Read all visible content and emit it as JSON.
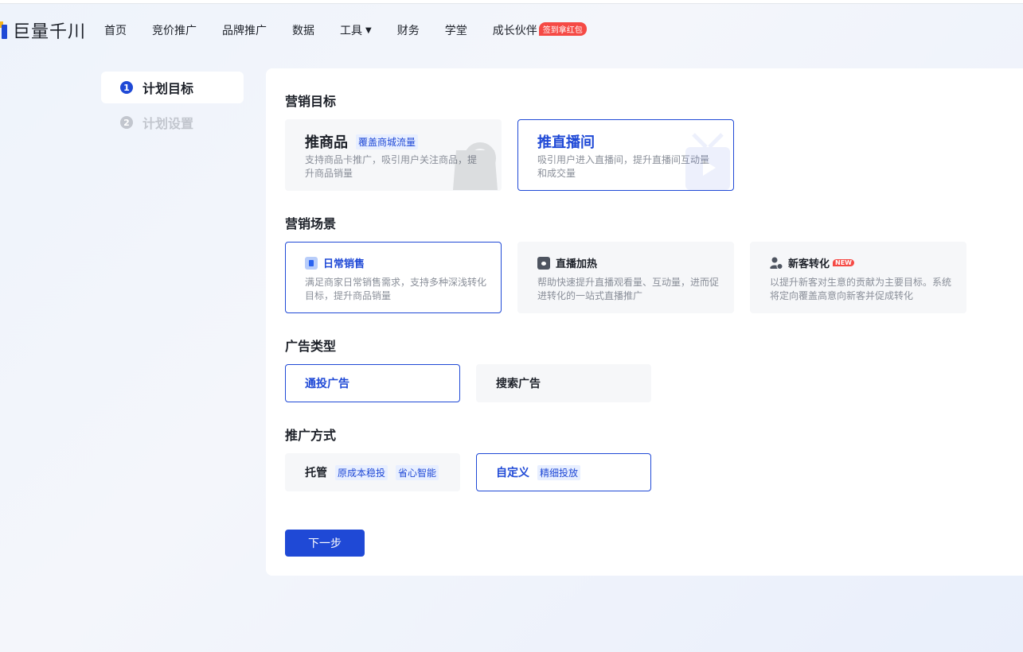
{
  "app": {
    "logo_text": "巨量千川"
  },
  "nav": {
    "items": [
      {
        "label": "首页"
      },
      {
        "label": "竞价推广"
      },
      {
        "label": "品牌推广"
      },
      {
        "label": "数据"
      },
      {
        "label": "工具"
      },
      {
        "label": "财务"
      },
      {
        "label": "学堂"
      },
      {
        "label": "成长伙伴"
      }
    ],
    "tools_caret": "▼",
    "growth_badge": "签到拿红包"
  },
  "steps": [
    {
      "num": "1",
      "label": "计划目标",
      "active": true
    },
    {
      "num": "2",
      "label": "计划设置",
      "active": false
    }
  ],
  "sections": {
    "marketing_goal": {
      "title": "营销目标",
      "cards": [
        {
          "title": "推商品",
          "tag": "覆盖商城流量",
          "desc": "支持商品卡推广，吸引用户关注商品，提升商品销量",
          "selected": false
        },
        {
          "title": "推直播间",
          "desc": "吸引用户进入直播间，提升直播间互动量和成交量",
          "selected": true
        }
      ]
    },
    "marketing_scene": {
      "title": "营销场景",
      "cards": [
        {
          "title": "日常销售",
          "icon": "sales-icon",
          "desc": "满足商家日常销售需求，支持多种深浅转化目标，提升商品销量",
          "selected": true
        },
        {
          "title": "直播加热",
          "icon": "live-heat-icon",
          "desc": "帮助快速提升直播观看量、互动量，进而促进转化的一站式直播推广",
          "selected": false
        },
        {
          "title": "新客转化",
          "icon": "new-customer-icon",
          "badge": "NEW",
          "desc": "以提升新客对生意的贡献为主要目标。系统将定向覆盖高意向新客并促成转化",
          "selected": false
        }
      ]
    },
    "ad_type": {
      "title": "广告类型",
      "options": [
        {
          "label": "通投广告",
          "selected": true
        },
        {
          "label": "搜索广告",
          "selected": false
        }
      ]
    },
    "promo_method": {
      "title": "推广方式",
      "options": [
        {
          "label": "托管",
          "tags": [
            "原成本稳投",
            "省心智能"
          ],
          "selected": false
        },
        {
          "label": "自定义",
          "tags": [
            "精细投放"
          ],
          "selected": true
        }
      ]
    }
  },
  "next_button": "下一步",
  "colors": {
    "primary": "#1f49d6",
    "badge_red": "#f54a45"
  }
}
